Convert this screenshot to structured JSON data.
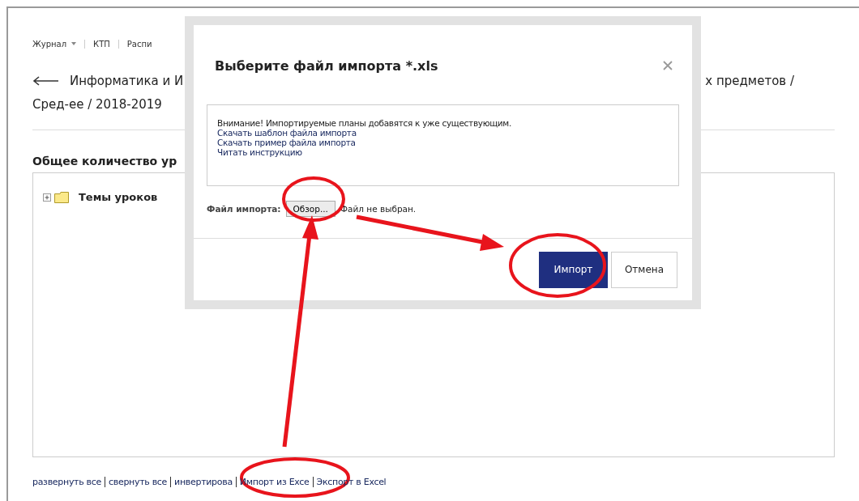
{
  "nav": [
    {
      "label": "Журнал",
      "dropdown": true
    },
    {
      "label": "КТП",
      "dropdown": false
    },
    {
      "label": "Распи",
      "dropdown": false
    }
  ],
  "breadcrumb": {
    "left": "Информатика и И",
    "right": "х предметов /",
    "second_line": "Сред-ее / 2018-2019"
  },
  "section_title": "Общее количество ур",
  "tree": [
    {
      "label": "Темы уроков",
      "expanded": false
    }
  ],
  "footer_links": [
    "развернуть все",
    "свернуть все",
    "инвертирова",
    "Импорт из Exce",
    "Экспорт в Excel"
  ],
  "dialog": {
    "title": "Выберите файл импорта *.xls",
    "info": [
      {
        "kind": "text",
        "text": "Внимание! Импортируемые планы добавятся к уже существующим."
      },
      {
        "kind": "link",
        "text": "Скачать шаблон файла импорта"
      },
      {
        "kind": "link",
        "text": "Скачать пример файла импорта"
      },
      {
        "kind": "link",
        "text": "Читать инструкцию"
      }
    ],
    "file_label": "Файл импорта:",
    "browse_button": "Обзор...",
    "file_status": "Файл не выбран.",
    "buttons": [
      {
        "label": "Импорт",
        "kind": "primary"
      },
      {
        "label": "Отмена",
        "kind": "default"
      }
    ]
  }
}
